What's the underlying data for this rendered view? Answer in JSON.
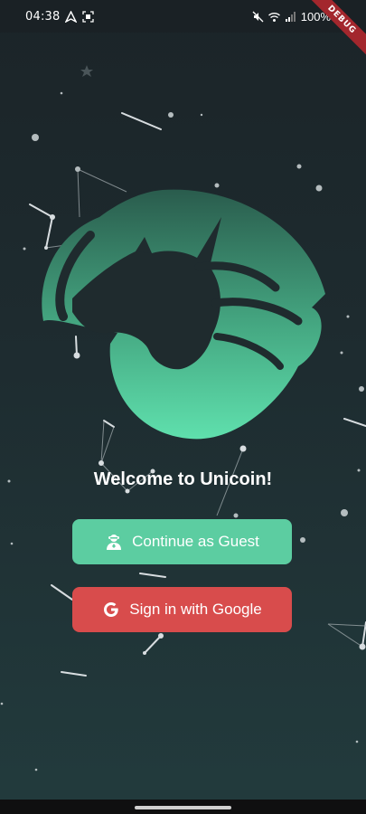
{
  "status_bar": {
    "time": "04:38",
    "battery_text": "100%",
    "icons": [
      "navigation-icon",
      "screenshot-icon",
      "mute-icon",
      "wifi-icon",
      "signal-icon",
      "battery-icon"
    ]
  },
  "debug_banner": "DEBUG",
  "logo": {
    "name": "unicorn-logo",
    "color_top": "#2a5c4d",
    "color_bottom": "#5fe0ad"
  },
  "welcome_text": "Welcome to Unicoin!",
  "buttons": {
    "guest": {
      "label": "Continue as Guest",
      "icon": "guest-user-icon",
      "color": "#5ccda1"
    },
    "google": {
      "label": "Sign in with Google",
      "icon": "google-g-icon",
      "color": "#d84c4c"
    }
  }
}
